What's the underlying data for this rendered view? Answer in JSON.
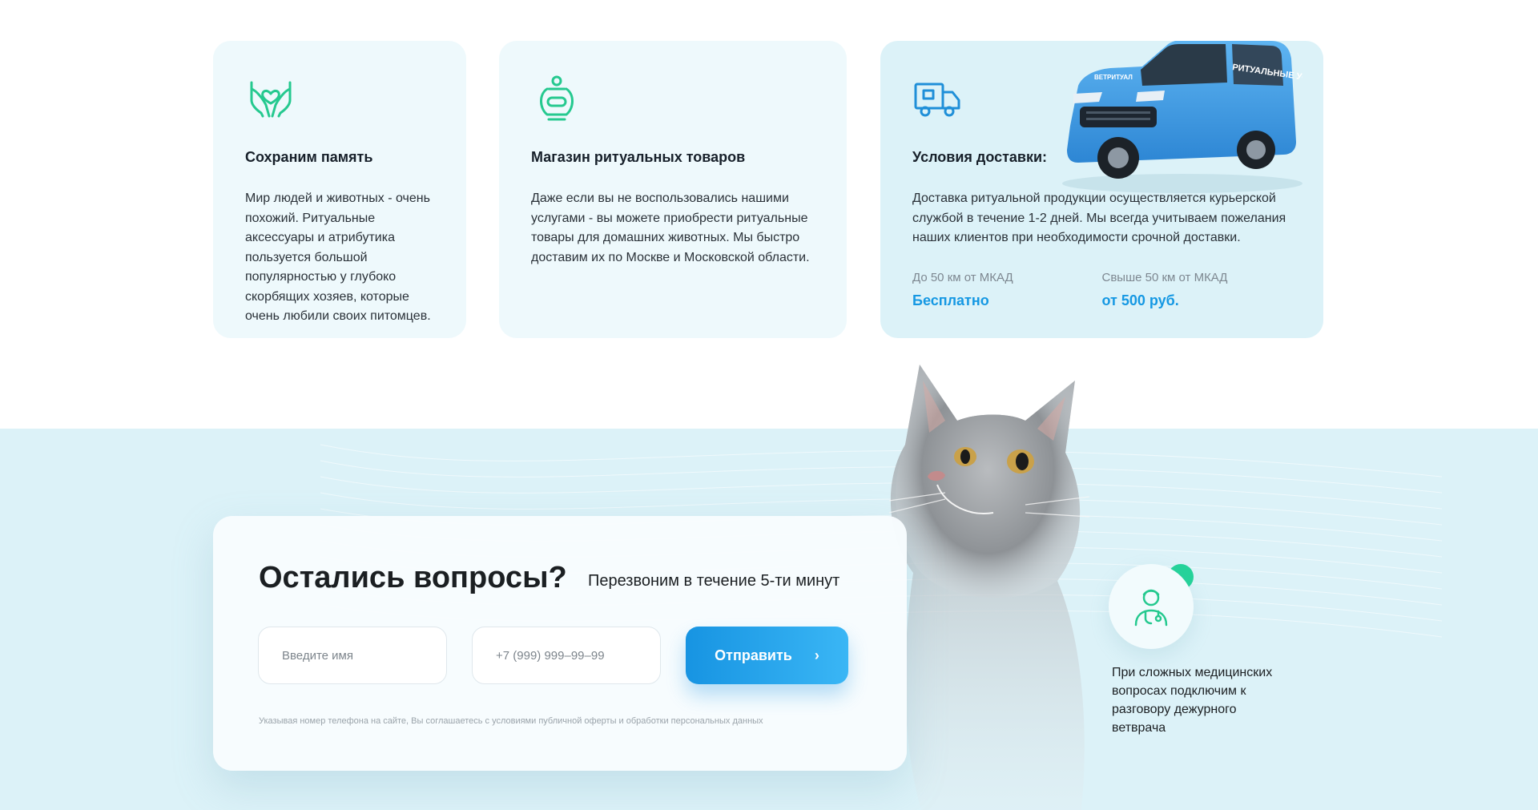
{
  "cards": [
    {
      "icon": "heart-hands-icon",
      "title": "Сохраним память",
      "text": "Мир людей и животных - очень похожий. Ритуальные аксессуары и атрибутика пользуется большой популярностью у глубоко скорбящих хозяев, которые очень любили своих питомцев."
    },
    {
      "icon": "urn-icon",
      "title": "Магазин ритуальных товаров",
      "text": "Даже если вы не воспользовались нашими услугами - вы можете приобрести ритуальные товары для домашних животных. Мы быстро доставим их по Москве и Московской области."
    },
    {
      "icon": "truck-icon",
      "title": "Условия доставки:",
      "text": "Доставка ритуальной продукции осуществляется курьерской службой в течение 1-2 дней. Мы всегда учитываем пожелания наших клиентов при необходимости срочной доставки.",
      "delivery": [
        {
          "label": "До 50 км от МКАД",
          "value": "Бесплатно"
        },
        {
          "label": "Свыше 50 км от МКАД",
          "value": "от 500 руб."
        }
      ],
      "van_text_side": "РИТУАЛЬНЫЕ УСЛУГИ",
      "van_text_hood": "ВЕТРИТУАЛ"
    }
  ],
  "form": {
    "title": "Остались вопросы?",
    "subtitle": "Перезвоним в течение 5-ти минут",
    "name_placeholder": "Введите имя",
    "phone_placeholder": "+7 (999) 999–99–99",
    "submit_label": "Отправить",
    "disclaimer": "Указывая номер телефона на сайте, Вы соглашаетесь с условиями публичной оферты и обработки персональных данных"
  },
  "vet": {
    "icon": "doctor-icon",
    "text": "При сложных медицинских вопросах подключим к разговору дежурного ветврача"
  },
  "colors": {
    "accent_green": "#25d39a",
    "accent_blue": "#1598e3",
    "card_bg": "#eef9fc",
    "band_bg": "#dcf2f8"
  }
}
